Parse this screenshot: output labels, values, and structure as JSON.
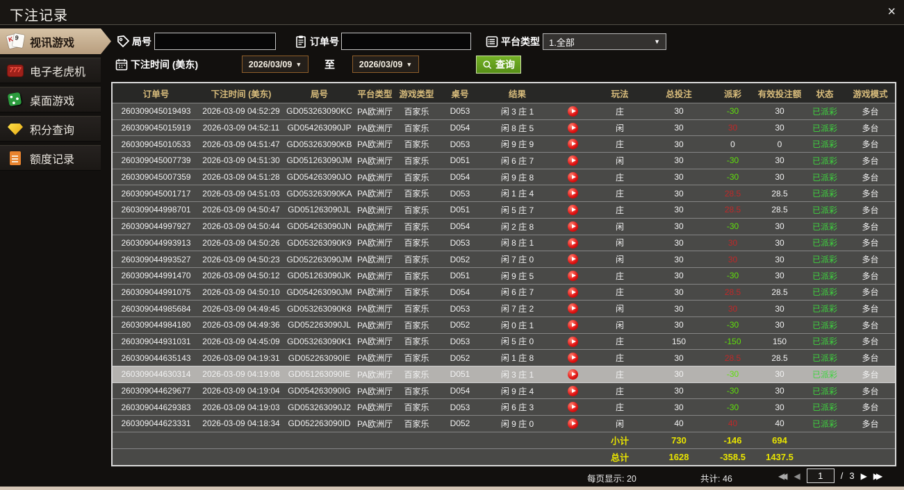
{
  "window": {
    "title": "下注记录",
    "close_glyph": "×"
  },
  "ui": {
    "caret_down": "▼"
  },
  "sidebar": {
    "items": [
      {
        "id": "video-games",
        "label": "视讯游戏",
        "icon": "cards",
        "active": true
      },
      {
        "id": "slot-machines",
        "label": "电子老虎机",
        "icon": "slot-777",
        "active": false,
        "badge": "777"
      },
      {
        "id": "table-games",
        "label": "桌面游戏",
        "icon": "dice",
        "active": false
      },
      {
        "id": "points-query",
        "label": "积分查询",
        "icon": "gem",
        "active": false
      },
      {
        "id": "quota-records",
        "label": "额度记录",
        "icon": "doc",
        "active": false
      }
    ]
  },
  "filters": {
    "round_label": "局号",
    "order_label": "订单号",
    "platform_label": "平台类型",
    "platform_value": "1.全部",
    "time_label": "下注时间 (美东)",
    "date_from": "2026/03/09",
    "to_label": "至",
    "date_to": "2026/03/09",
    "query_label": "查询"
  },
  "table": {
    "headers": {
      "order": "订单号",
      "time": "下注时间 (美东)",
      "round": "局号",
      "platform": "平台类型",
      "game": "游戏类型",
      "table_no": "桌号",
      "result": "结果",
      "play": "",
      "bet_type": "玩法",
      "total_bet": "总投注",
      "payout": "派彩",
      "valid_bet": "有效投注额",
      "status": "状态",
      "mode": "游戏模式"
    },
    "rows": [
      {
        "order": "260309045019493",
        "time": "2026-03-09 04:52:29",
        "round": "GD053263090KC",
        "platform": "PA欧洲厅",
        "game": "百家乐",
        "table_no": "D053",
        "result": "闲 3 庄 1",
        "bet_type": "庄",
        "total_bet": "30",
        "payout": "-30",
        "valid_bet": "30",
        "status": "已派彩",
        "mode": "多台",
        "selected": false
      },
      {
        "order": "260309045015919",
        "time": "2026-03-09 04:52:11",
        "round": "GD054263090JP",
        "platform": "PA欧洲厅",
        "game": "百家乐",
        "table_no": "D054",
        "result": "闲 8 庄 5",
        "bet_type": "闲",
        "total_bet": "30",
        "payout": "30",
        "valid_bet": "30",
        "status": "已派彩",
        "mode": "多台",
        "selected": false
      },
      {
        "order": "260309045010533",
        "time": "2026-03-09 04:51:47",
        "round": "GD053263090KB",
        "platform": "PA欧洲厅",
        "game": "百家乐",
        "table_no": "D053",
        "result": "闲 9 庄 9",
        "bet_type": "庄",
        "total_bet": "30",
        "payout": "0",
        "valid_bet": "0",
        "status": "已派彩",
        "mode": "多台",
        "selected": false
      },
      {
        "order": "260309045007739",
        "time": "2026-03-09 04:51:30",
        "round": "GD051263090JM",
        "platform": "PA欧洲厅",
        "game": "百家乐",
        "table_no": "D051",
        "result": "闲 6 庄 7",
        "bet_type": "闲",
        "total_bet": "30",
        "payout": "-30",
        "valid_bet": "30",
        "status": "已派彩",
        "mode": "多台",
        "selected": false
      },
      {
        "order": "260309045007359",
        "time": "2026-03-09 04:51:28",
        "round": "GD054263090JO",
        "platform": "PA欧洲厅",
        "game": "百家乐",
        "table_no": "D054",
        "result": "闲 9 庄 8",
        "bet_type": "庄",
        "total_bet": "30",
        "payout": "-30",
        "valid_bet": "30",
        "status": "已派彩",
        "mode": "多台",
        "selected": false
      },
      {
        "order": "260309045001717",
        "time": "2026-03-09 04:51:03",
        "round": "GD053263090KA",
        "platform": "PA欧洲厅",
        "game": "百家乐",
        "table_no": "D053",
        "result": "闲 1 庄 4",
        "bet_type": "庄",
        "total_bet": "30",
        "payout": "28.5",
        "valid_bet": "28.5",
        "status": "已派彩",
        "mode": "多台",
        "selected": false
      },
      {
        "order": "260309044998701",
        "time": "2026-03-09 04:50:47",
        "round": "GD051263090JL",
        "platform": "PA欧洲厅",
        "game": "百家乐",
        "table_no": "D051",
        "result": "闲 5 庄 7",
        "bet_type": "庄",
        "total_bet": "30",
        "payout": "28.5",
        "valid_bet": "28.5",
        "status": "已派彩",
        "mode": "多台",
        "selected": false
      },
      {
        "order": "260309044997927",
        "time": "2026-03-09 04:50:44",
        "round": "GD054263090JN",
        "platform": "PA欧洲厅",
        "game": "百家乐",
        "table_no": "D054",
        "result": "闲 2 庄 8",
        "bet_type": "闲",
        "total_bet": "30",
        "payout": "-30",
        "valid_bet": "30",
        "status": "已派彩",
        "mode": "多台",
        "selected": false
      },
      {
        "order": "260309044993913",
        "time": "2026-03-09 04:50:26",
        "round": "GD053263090K9",
        "platform": "PA欧洲厅",
        "game": "百家乐",
        "table_no": "D053",
        "result": "闲 8 庄 1",
        "bet_type": "闲",
        "total_bet": "30",
        "payout": "30",
        "valid_bet": "30",
        "status": "已派彩",
        "mode": "多台",
        "selected": false
      },
      {
        "order": "260309044993527",
        "time": "2026-03-09 04:50:23",
        "round": "GD052263090JM",
        "platform": "PA欧洲厅",
        "game": "百家乐",
        "table_no": "D052",
        "result": "闲 7 庄 0",
        "bet_type": "闲",
        "total_bet": "30",
        "payout": "30",
        "valid_bet": "30",
        "status": "已派彩",
        "mode": "多台",
        "selected": false
      },
      {
        "order": "260309044991470",
        "time": "2026-03-09 04:50:12",
        "round": "GD051263090JK",
        "platform": "PA欧洲厅",
        "game": "百家乐",
        "table_no": "D051",
        "result": "闲 9 庄 5",
        "bet_type": "庄",
        "total_bet": "30",
        "payout": "-30",
        "valid_bet": "30",
        "status": "已派彩",
        "mode": "多台",
        "selected": false
      },
      {
        "order": "260309044991075",
        "time": "2026-03-09 04:50:10",
        "round": "GD054263090JM",
        "platform": "PA欧洲厅",
        "game": "百家乐",
        "table_no": "D054",
        "result": "闲 6 庄 7",
        "bet_type": "庄",
        "total_bet": "30",
        "payout": "28.5",
        "valid_bet": "28.5",
        "status": "已派彩",
        "mode": "多台",
        "selected": false
      },
      {
        "order": "260309044985684",
        "time": "2026-03-09 04:49:45",
        "round": "GD053263090K8",
        "platform": "PA欧洲厅",
        "game": "百家乐",
        "table_no": "D053",
        "result": "闲 7 庄 2",
        "bet_type": "闲",
        "total_bet": "30",
        "payout": "30",
        "valid_bet": "30",
        "status": "已派彩",
        "mode": "多台",
        "selected": false
      },
      {
        "order": "260309044984180",
        "time": "2026-03-09 04:49:36",
        "round": "GD052263090JL",
        "platform": "PA欧洲厅",
        "game": "百家乐",
        "table_no": "D052",
        "result": "闲 0 庄 1",
        "bet_type": "闲",
        "total_bet": "30",
        "payout": "-30",
        "valid_bet": "30",
        "status": "已派彩",
        "mode": "多台",
        "selected": false
      },
      {
        "order": "260309044931031",
        "time": "2026-03-09 04:45:09",
        "round": "GD053263090K1",
        "platform": "PA欧洲厅",
        "game": "百家乐",
        "table_no": "D053",
        "result": "闲 5 庄 0",
        "bet_type": "庄",
        "total_bet": "150",
        "payout": "-150",
        "valid_bet": "150",
        "status": "已派彩",
        "mode": "多台",
        "selected": false
      },
      {
        "order": "260309044635143",
        "time": "2026-03-09 04:19:31",
        "round": "GD052263090IE",
        "platform": "PA欧洲厅",
        "game": "百家乐",
        "table_no": "D052",
        "result": "闲 1 庄 8",
        "bet_type": "庄",
        "total_bet": "30",
        "payout": "28.5",
        "valid_bet": "28.5",
        "status": "已派彩",
        "mode": "多台",
        "selected": false
      },
      {
        "order": "260309044630314",
        "time": "2026-03-09 04:19:08",
        "round": "GD051263090IE",
        "platform": "PA欧洲厅",
        "game": "百家乐",
        "table_no": "D051",
        "result": "闲 3 庄 1",
        "bet_type": "庄",
        "total_bet": "30",
        "payout": "-30",
        "valid_bet": "30",
        "status": "已派彩",
        "mode": "多台",
        "selected": true
      },
      {
        "order": "260309044629677",
        "time": "2026-03-09 04:19:04",
        "round": "GD054263090IG",
        "platform": "PA欧洲厅",
        "game": "百家乐",
        "table_no": "D054",
        "result": "闲 9 庄 4",
        "bet_type": "庄",
        "total_bet": "30",
        "payout": "-30",
        "valid_bet": "30",
        "status": "已派彩",
        "mode": "多台",
        "selected": false
      },
      {
        "order": "260309044629383",
        "time": "2026-03-09 04:19:03",
        "round": "GD053263090J2",
        "platform": "PA欧洲厅",
        "game": "百家乐",
        "table_no": "D053",
        "result": "闲 6 庄 3",
        "bet_type": "庄",
        "total_bet": "30",
        "payout": "-30",
        "valid_bet": "30",
        "status": "已派彩",
        "mode": "多台",
        "selected": false
      },
      {
        "order": "260309044623331",
        "time": "2026-03-09 04:18:34",
        "round": "GD052263090ID",
        "platform": "PA欧洲厅",
        "game": "百家乐",
        "table_no": "D052",
        "result": "闲 9 庄 0",
        "bet_type": "闲",
        "total_bet": "40",
        "payout": "40",
        "valid_bet": "40",
        "status": "已派彩",
        "mode": "多台",
        "selected": false
      }
    ],
    "subtotal": {
      "name": "subtotal-row",
      "label": "小计",
      "total_bet": "730",
      "payout": "-146",
      "valid_bet": "694"
    },
    "grand_total": {
      "name": "grand-total-row",
      "label": "总计",
      "total_bet": "1628",
      "payout": "-358.5",
      "valid_bet": "1437.5"
    }
  },
  "footer": {
    "per_page": "每页显示: 20",
    "total_count": "共计: 46",
    "page_current": "1",
    "page_sep": "/",
    "page_total": "3",
    "first_glyph": "◀◀",
    "prev_glyph": "◀",
    "next_glyph": "▶",
    "last_glyph": "▶▶"
  },
  "colors": {
    "accent_tan": "#c9b493",
    "header_gold": "#d9bd7c",
    "row_bg": "#494947",
    "selected_row_bg": "#b4b2af",
    "payout_negative": "#5fe00a",
    "payout_positive": "#c02828",
    "status_green": "#3ed43e",
    "totals_yellow": "#e8e400",
    "query_green": "#61a11f",
    "play_red": "#e01212",
    "date_border": "#8f5e2a"
  }
}
